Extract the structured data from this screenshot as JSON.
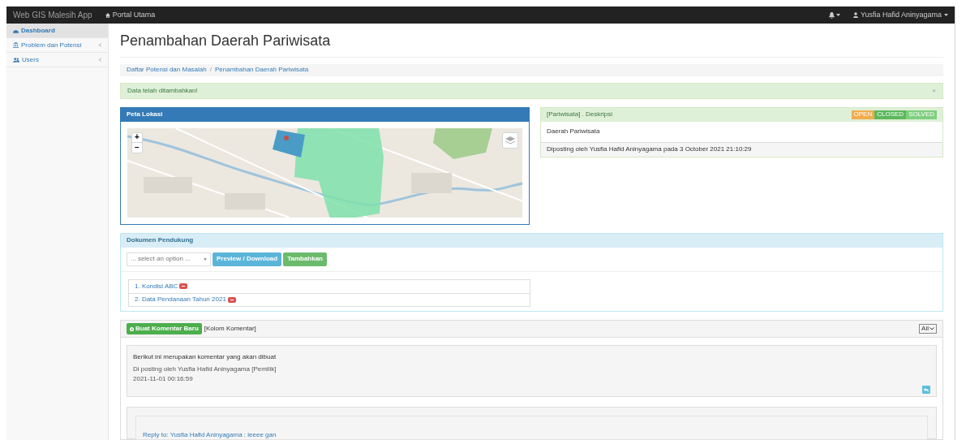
{
  "navbar": {
    "brand": "Web GIS Malesih App",
    "link": "Portal Utama",
    "user": "Yusfia Hafid Aninyagama"
  },
  "sidebar": {
    "items": [
      {
        "label": "Dashboard",
        "selected": true,
        "expandable": false
      },
      {
        "label": "Problem dan Potensi",
        "selected": false,
        "expandable": true
      },
      {
        "label": "Users",
        "selected": false,
        "expandable": true
      }
    ]
  },
  "page_title": "Penambahan Daerah Pariwisata",
  "breadcrumb": {
    "items": [
      "Daftar Potensi dan Masalah",
      "Penambahan Daerah Pariwisata"
    ],
    "separator": "/"
  },
  "alert": {
    "text": "Data telah ditambahkan!",
    "close": "×"
  },
  "map_panel": {
    "title": "Peta Lokasi",
    "zoom_in": "+",
    "zoom_out": "−"
  },
  "description_panel": {
    "title": "[Pariwisata] . Deskripsi",
    "statuses": [
      {
        "label": "OPEN",
        "color": "#f0ad4e"
      },
      {
        "label": "CLOSED",
        "color": "#5cb85c"
      },
      {
        "label": "SOLVED",
        "color": "#7fcf7f"
      }
    ],
    "body": "Daerah Pariwisata",
    "footer": "Diposting oleh Yusfia Hafid Aninyagama pada 3 October 2021 21:10:29"
  },
  "documents_panel": {
    "title": "Dokumen Pendukung",
    "select_placeholder": "... select an option ...",
    "preview_button": "Preview / Download",
    "add_button": "Tambahkan",
    "documents": [
      "1. Kondisi ABC",
      "2. Data Pendanaan Tahun 2021"
    ]
  },
  "comments_panel": {
    "new_button": "Buat Komentar Baru",
    "title": "[Kolom Komentar]",
    "filter": "All",
    "comments": [
      {
        "text": "Berikut ini merupakan komentar yang akan dibuat",
        "author": "Di posting oleh Yusfia Hafid Aninyagama [Pemilik]",
        "time": "2021-11-01 00:16:59"
      }
    ],
    "reply": "Reply to: Yusfia Hafid Aninyagama : ieeee gan"
  }
}
